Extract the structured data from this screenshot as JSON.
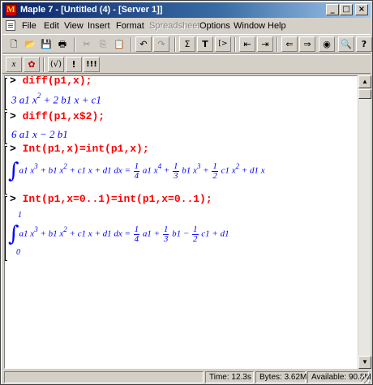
{
  "window": {
    "title": "Maple 7 - [Untitled (4) - [Server 1]]",
    "icon_letter": "M",
    "controls": [
      "minimize-icon",
      "maximize-icon",
      "close-icon"
    ]
  },
  "menu": [
    {
      "label": "File",
      "enabled": true
    },
    {
      "label": "Edit",
      "enabled": true
    },
    {
      "label": "View",
      "enabled": true
    },
    {
      "label": "Insert",
      "enabled": true
    },
    {
      "label": "Format",
      "enabled": true
    },
    {
      "label": "Spreadsheet",
      "enabled": false
    },
    {
      "label": "Options",
      "enabled": true
    },
    {
      "label": "Window",
      "enabled": true
    },
    {
      "label": "Help",
      "enabled": true
    }
  ],
  "toolbar1": [
    {
      "name": "new-document-icon",
      "glyph": "🗋"
    },
    {
      "name": "open-folder-icon",
      "glyph": "📂"
    },
    {
      "name": "save-icon",
      "glyph": "💾"
    },
    {
      "name": "print-icon",
      "glyph": "🖶"
    },
    {
      "name": "cut-icon",
      "glyph": "✂"
    },
    {
      "name": "copy-icon",
      "glyph": "⎘"
    },
    {
      "name": "paste-icon",
      "glyph": "📋"
    },
    {
      "name": "undo-icon",
      "glyph": "↶"
    },
    {
      "name": "redo-icon",
      "glyph": "↷"
    },
    {
      "name": "sigma-icon",
      "glyph": "Σ"
    },
    {
      "name": "text-t-icon",
      "glyph": "T"
    },
    {
      "name": "insert-prompt-icon",
      "glyph": "[>"
    },
    {
      "name": "outdent-icon",
      "glyph": "⇤"
    },
    {
      "name": "indent-icon",
      "glyph": "⇥"
    },
    {
      "name": "back-arrow-icon",
      "glyph": "⇐"
    },
    {
      "name": "forward-arrow-icon",
      "glyph": "⇒"
    },
    {
      "name": "stop-icon",
      "glyph": "◉"
    },
    {
      "name": "zoom-icon",
      "glyph": "🔍"
    },
    {
      "name": "help-icon",
      "glyph": "?"
    }
  ],
  "toolbar2": [
    {
      "name": "math-mode-icon",
      "glyph": "x"
    },
    {
      "name": "maple-leaf-icon",
      "glyph": "✿"
    },
    {
      "name": "auto-correct-icon",
      "glyph": "(√)"
    },
    {
      "name": "execute-icon",
      "glyph": "!"
    },
    {
      "name": "execute-all-icon",
      "glyph": "!!!"
    }
  ],
  "worksheet": {
    "prompt_symbol": ">",
    "inputs": [
      "diff(p1,x);",
      "diff(p1,x$2);",
      "Int(p1,x)=int(p1,x);",
      "Int(p1,x=0..1)=int(p1,x=0..1);"
    ],
    "outputs": {
      "o1": {
        "a": "3 a1 x",
        "e1": "2",
        "b": " + 2 b1 x + c1"
      },
      "o2": {
        "a": "6 a1 x − 2 b1"
      },
      "o3": {
        "integral": "∫",
        "body": "a1 x",
        "e1": "3",
        "t2": " + b1 x",
        "e2": "2",
        "t3": " + c1 x + d1 dx = ",
        "f1n": "1",
        "f1d": "4",
        "t4": " a1 x",
        "e3": "4",
        "t5": " + ",
        "f2n": "1",
        "f2d": "3",
        "t6": " b1 x",
        "e4": "3",
        "t7": " + ",
        "f3n": "1",
        "f3d": "2",
        "t8": " c1 x",
        "e5": "2",
        "t9": " + d1 x"
      },
      "o4": {
        "integral": "∫",
        "upper": "1",
        "lower": "0",
        "body": "a1 x",
        "e1": "3",
        "t2": " + b1 x",
        "e2": "2",
        "t3": " + c1 x + d1 dx = ",
        "f1n": "1",
        "f1d": "4",
        "t4": " a1 + ",
        "f2n": "1",
        "f2d": "3",
        "t5": " b1 − ",
        "f3n": "1",
        "f3d": "2",
        "t6": " c1 + d1"
      }
    }
  },
  "status": {
    "time": "Time: 12.3s",
    "bytes": "Bytes: 3.62M",
    "available": "Available: 90.8M"
  }
}
